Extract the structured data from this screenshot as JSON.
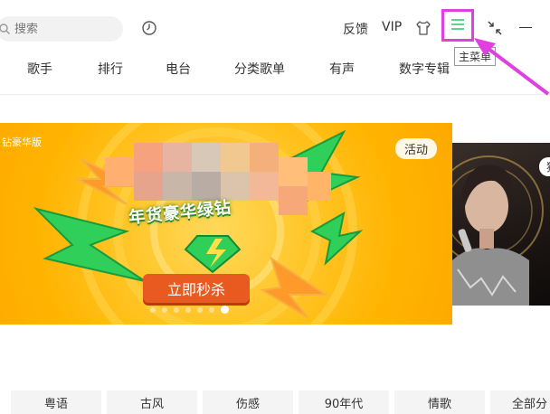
{
  "search": {
    "placeholder": "搜索"
  },
  "header": {
    "feedback_label": "反馈",
    "vip_label": "VIP",
    "main_menu_tooltip": "主菜单"
  },
  "nav": {
    "tabs": [
      {
        "label": "歌手"
      },
      {
        "label": "排行"
      },
      {
        "label": "电台"
      },
      {
        "label": "分类歌单"
      },
      {
        "label": "有声"
      },
      {
        "label": "数字专辑"
      }
    ]
  },
  "banner": {
    "edition_label": "钻豪华版",
    "activity_tag": "活动",
    "headline": "年货豪华绿钻",
    "cta_label": "立即秒杀",
    "slide_index": 7,
    "slide_count": 7
  },
  "side_banner": {
    "tag": "独"
  },
  "genres": [
    {
      "label": "粤语"
    },
    {
      "label": "古风"
    },
    {
      "label": "伤感"
    },
    {
      "label": "90年代"
    },
    {
      "label": "情歌"
    },
    {
      "label": "全部分"
    }
  ],
  "colors": {
    "highlight": "#e040e0",
    "menu_icon": "#2ecc71",
    "banner_bg": "#ffc629",
    "cta_bg": "#e85a20"
  },
  "icons": {
    "search": "search-icon",
    "history": "history-icon",
    "skin": "tshirt-icon",
    "menu": "hamburger-menu-icon",
    "mini_mode": "collapse-icon",
    "minimize": "minimize-icon"
  }
}
